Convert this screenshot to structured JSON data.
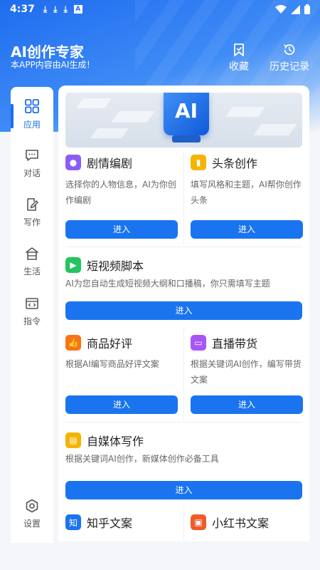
{
  "status": {
    "time": "4:37",
    "a_badge": "A"
  },
  "header": {
    "title": "AI创作专家",
    "subtitle": "本APP内容由AI生成！"
  },
  "actions": {
    "favorite_label": "收藏",
    "history_label": "历史记录"
  },
  "sidebar": {
    "items": [
      {
        "label": "应用",
        "icon": "grid-icon"
      },
      {
        "label": "对话",
        "icon": "chat-icon"
      },
      {
        "label": "写作",
        "icon": "write-icon"
      },
      {
        "label": "生活",
        "icon": "house-icon"
      },
      {
        "label": "指令",
        "icon": "code-icon"
      },
      {
        "label": "设置",
        "icon": "settings-icon"
      }
    ]
  },
  "banner": {
    "text": "AI"
  },
  "cards": [
    {
      "title": "剧情编剧",
      "desc": "选择你的人物信息，AI为你创作编剧",
      "button": "进入",
      "color": "#8b5cf6"
    },
    {
      "title": "头条创作",
      "desc": "填写风格和主题，AI帮你创作头条",
      "button": "进入",
      "color": "#f5b400"
    },
    {
      "title": "短视频脚本",
      "desc": "AI为您自动生成短视频大纲和口播稿，你只需填写主题",
      "button": "进入",
      "color": "#22c55e"
    },
    {
      "title": "商品好评",
      "desc": "根据AI编写商品好评文案",
      "button": "进入",
      "color": "#f97316"
    },
    {
      "title": "直播带货",
      "desc": "根据关键词AI创作，编写带货文案",
      "button": "进入",
      "color": "#a855f7"
    },
    {
      "title": "自媒体写作",
      "desc": "根据关键词AI创作，新媒体创作必备工具",
      "button": "进入",
      "color": "#f5b400"
    },
    {
      "title": "知乎文案",
      "color": "#1a74ef"
    },
    {
      "title": "小红书文案",
      "color": "#f05a28"
    }
  ],
  "colors": {
    "accent": "#1a74ef",
    "header_start": "#1f6cf0"
  }
}
